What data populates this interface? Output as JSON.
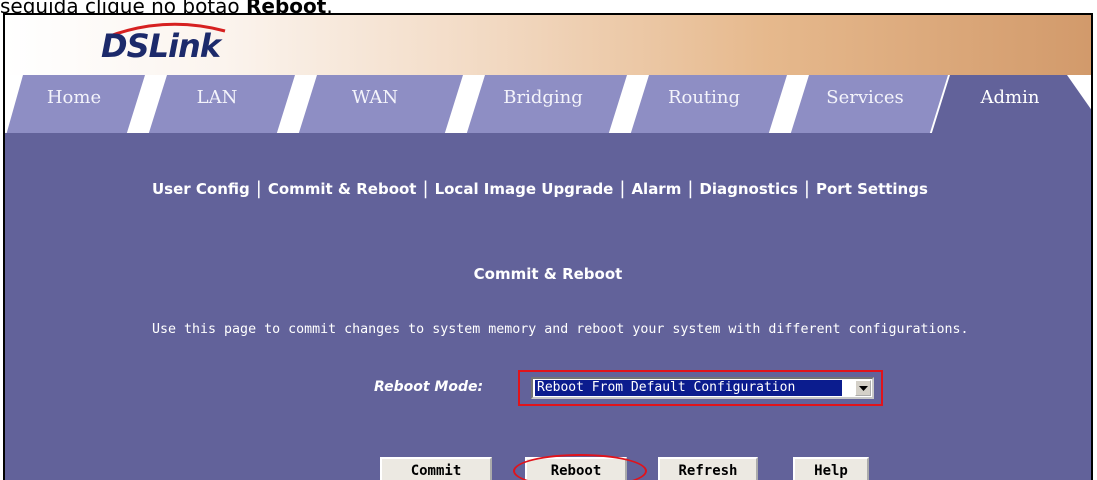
{
  "caption": {
    "prefix": "seguida clique no botão ",
    "bold": "Reboot",
    "suffix": "."
  },
  "brand": {
    "logo_text": "DSLink"
  },
  "tabs": [
    {
      "label": "Home",
      "active": false
    },
    {
      "label": "LAN",
      "active": false
    },
    {
      "label": "WAN",
      "active": false
    },
    {
      "label": "Bridging",
      "active": false
    },
    {
      "label": "Routing",
      "active": false
    },
    {
      "label": "Services",
      "active": false
    },
    {
      "label": "Admin",
      "active": true
    }
  ],
  "subnav": {
    "items": [
      "User Config",
      "Commit & Reboot",
      "Local Image Upgrade",
      "Alarm",
      "Diagnostics",
      "Port Settings"
    ],
    "separator": "|"
  },
  "page": {
    "title": "Commit & Reboot",
    "description": "Use this page to commit changes to system memory and reboot your system with different configurations."
  },
  "form": {
    "reboot_mode_label": "Reboot Mode:",
    "reboot_mode_value": "Reboot From Default Configuration"
  },
  "buttons": {
    "commit": "Commit",
    "reboot": "Reboot",
    "refresh": "Refresh",
    "help": "Help"
  },
  "colors": {
    "panel": "#62629a",
    "tab": "#8e8ec4",
    "highlight": "#e0131b",
    "selection": "#0b1c8e"
  }
}
